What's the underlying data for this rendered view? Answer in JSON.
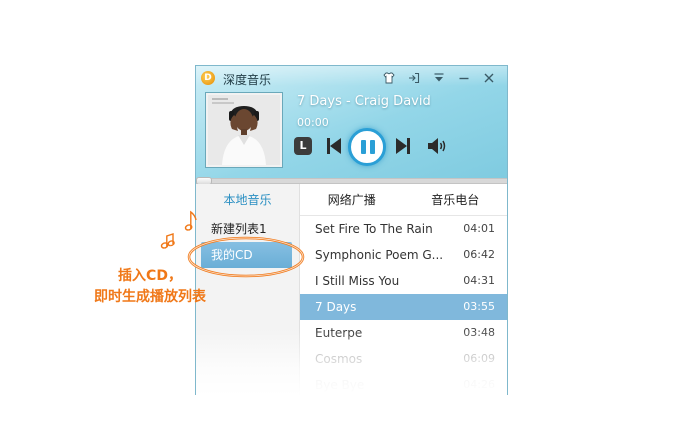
{
  "app": {
    "title": "深度音乐",
    "logo_letter": "D"
  },
  "window_controls": [
    {
      "name": "skin-icon"
    },
    {
      "name": "mini-mode-icon"
    },
    {
      "name": "menu-icon"
    },
    {
      "name": "minimize-icon"
    },
    {
      "name": "close-icon"
    }
  ],
  "player": {
    "song_title": "7 Days - Craig David",
    "time": "00:00",
    "mode_label": "L",
    "progress": 0.0
  },
  "sidebar": {
    "header": "本地音乐",
    "items": [
      {
        "label": "新建列表1",
        "selected": false
      },
      {
        "label": "我的CD",
        "selected": true
      }
    ]
  },
  "tabs": [
    "网络广播",
    "音乐电台"
  ],
  "tracks": [
    {
      "title": "Set Fire To The Rain",
      "duration": "04:01"
    },
    {
      "title": "Symphonic Poem G...",
      "duration": "06:42"
    },
    {
      "title": "I Still Miss You",
      "duration": "04:31"
    },
    {
      "title": "7 Days",
      "duration": "03:55",
      "selected": true
    },
    {
      "title": "Euterpe",
      "duration": "03:48"
    },
    {
      "title": "Cosmos",
      "duration": "06:09"
    },
    {
      "title": "Bye Bye",
      "duration": "04:26"
    }
  ],
  "callout": {
    "line1": "插入CD，",
    "line2": "即时生成播放列表"
  },
  "colors": {
    "accent": "#2a9fd6",
    "selection": "#80b8dc",
    "callout": "#f07818",
    "header_gradient": "#93d6e8"
  }
}
